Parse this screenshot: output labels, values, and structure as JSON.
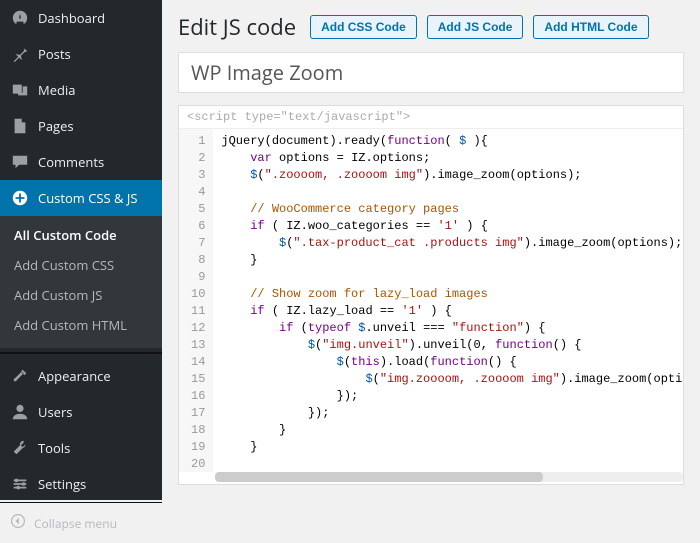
{
  "sidebar": {
    "items": [
      {
        "id": "dashboard",
        "label": "Dashboard"
      },
      {
        "id": "posts",
        "label": "Posts"
      },
      {
        "id": "media",
        "label": "Media"
      },
      {
        "id": "pages",
        "label": "Pages"
      },
      {
        "id": "comments",
        "label": "Comments"
      },
      {
        "id": "custom-css-js",
        "label": "Custom CSS & JS"
      },
      {
        "id": "appearance",
        "label": "Appearance"
      },
      {
        "id": "users",
        "label": "Users"
      },
      {
        "id": "tools",
        "label": "Tools"
      },
      {
        "id": "settings",
        "label": "Settings"
      }
    ],
    "submenu": [
      "All Custom Code",
      "Add Custom CSS",
      "Add Custom JS",
      "Add Custom HTML"
    ],
    "collapse": "Collapse menu"
  },
  "header": {
    "title": "Edit JS code",
    "buttons": [
      "Add CSS Code",
      "Add JS Code",
      "Add HTML Code"
    ]
  },
  "title_field": "WP Image Zoom",
  "editor": {
    "script_tag": "<script type=\"text/javascript\">",
    "lines": [
      [
        [
          "ident",
          "jQuery"
        ],
        [
          "punc",
          "("
        ],
        [
          "ident",
          "document"
        ],
        [
          "punc",
          ")."
        ],
        [
          "ident",
          "ready"
        ],
        [
          "punc",
          "("
        ],
        [
          "key",
          "function"
        ],
        [
          "punc",
          "( "
        ],
        [
          "var",
          "$"
        ],
        [
          "punc",
          " ){"
        ]
      ],
      [
        [
          "punc",
          "    "
        ],
        [
          "key",
          "var"
        ],
        [
          "punc",
          " "
        ],
        [
          "ident",
          "options"
        ],
        [
          "punc",
          " = "
        ],
        [
          "ident",
          "IZ"
        ],
        [
          "punc",
          "."
        ],
        [
          "ident",
          "options"
        ],
        [
          "punc",
          ";"
        ]
      ],
      [
        [
          "punc",
          "    "
        ],
        [
          "var",
          "$"
        ],
        [
          "punc",
          "("
        ],
        [
          "str",
          "\".zoooom, .zoooom img\""
        ],
        [
          "punc",
          ")."
        ],
        [
          "ident",
          "image_zoom"
        ],
        [
          "punc",
          "("
        ],
        [
          "ident",
          "options"
        ],
        [
          "punc",
          ");"
        ]
      ],
      [],
      [
        [
          "punc",
          "    "
        ],
        [
          "com",
          "// WooCommerce category pages"
        ]
      ],
      [
        [
          "punc",
          "    "
        ],
        [
          "key",
          "if"
        ],
        [
          "punc",
          " ( "
        ],
        [
          "ident",
          "IZ"
        ],
        [
          "punc",
          "."
        ],
        [
          "ident",
          "woo_categories"
        ],
        [
          "punc",
          " == "
        ],
        [
          "str",
          "'1'"
        ],
        [
          "punc",
          " ) {"
        ]
      ],
      [
        [
          "punc",
          "        "
        ],
        [
          "var",
          "$"
        ],
        [
          "punc",
          "("
        ],
        [
          "str",
          "\".tax-product_cat .products img\""
        ],
        [
          "punc",
          ")."
        ],
        [
          "ident",
          "image_zoom"
        ],
        [
          "punc",
          "("
        ],
        [
          "ident",
          "options"
        ],
        [
          "punc",
          ");"
        ]
      ],
      [
        [
          "punc",
          "    }"
        ]
      ],
      [],
      [
        [
          "punc",
          "    "
        ],
        [
          "com",
          "// Show zoom for lazy_load images"
        ]
      ],
      [
        [
          "punc",
          "    "
        ],
        [
          "key",
          "if"
        ],
        [
          "punc",
          " ( "
        ],
        [
          "ident",
          "IZ"
        ],
        [
          "punc",
          "."
        ],
        [
          "ident",
          "lazy_load"
        ],
        [
          "punc",
          " == "
        ],
        [
          "str",
          "'1'"
        ],
        [
          "punc",
          " ) {"
        ]
      ],
      [
        [
          "punc",
          "        "
        ],
        [
          "key",
          "if"
        ],
        [
          "punc",
          " ("
        ],
        [
          "key",
          "typeof"
        ],
        [
          "punc",
          " "
        ],
        [
          "var",
          "$"
        ],
        [
          "punc",
          "."
        ],
        [
          "ident",
          "unveil"
        ],
        [
          "punc",
          " === "
        ],
        [
          "str",
          "\"function\""
        ],
        [
          "punc",
          ") {"
        ]
      ],
      [
        [
          "punc",
          "            "
        ],
        [
          "var",
          "$"
        ],
        [
          "punc",
          "("
        ],
        [
          "str",
          "\"img.unveil\""
        ],
        [
          "punc",
          ")."
        ],
        [
          "ident",
          "unveil"
        ],
        [
          "punc",
          "("
        ],
        [
          "ident",
          "0"
        ],
        [
          "punc",
          ", "
        ],
        [
          "key",
          "function"
        ],
        [
          "punc",
          "() {"
        ]
      ],
      [
        [
          "punc",
          "                "
        ],
        [
          "var",
          "$"
        ],
        [
          "punc",
          "("
        ],
        [
          "key",
          "this"
        ],
        [
          "punc",
          ")."
        ],
        [
          "ident",
          "load"
        ],
        [
          "punc",
          "("
        ],
        [
          "key",
          "function"
        ],
        [
          "punc",
          "() {"
        ]
      ],
      [
        [
          "punc",
          "                    "
        ],
        [
          "var",
          "$"
        ],
        [
          "punc",
          "("
        ],
        [
          "str",
          "\"img.zoooom, .zoooom img\""
        ],
        [
          "punc",
          ")."
        ],
        [
          "ident",
          "image_zoom"
        ],
        [
          "punc",
          "("
        ],
        [
          "ident",
          "options"
        ]
      ],
      [
        [
          "punc",
          "                });"
        ]
      ],
      [
        [
          "punc",
          "            });"
        ]
      ],
      [
        [
          "punc",
          "        }"
        ]
      ],
      [
        [
          "punc",
          "    }"
        ]
      ],
      []
    ]
  }
}
